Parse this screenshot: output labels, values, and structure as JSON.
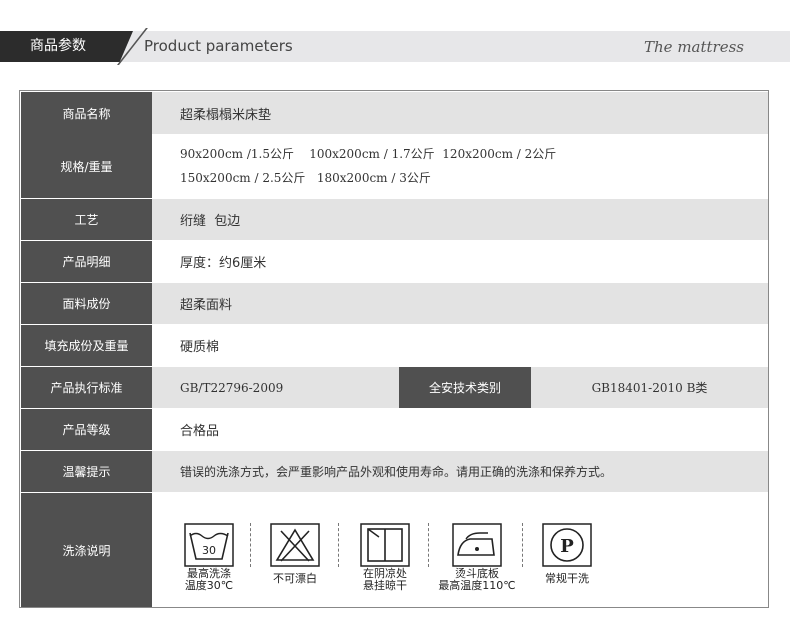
{
  "header": {
    "tab_label": "商品参数",
    "subtitle": "Product parameters",
    "brand": "The mattress"
  },
  "rows": {
    "name": {
      "label": "商品名称",
      "value": "超柔榻榻米床垫"
    },
    "spec": {
      "label": "规格/重量",
      "line1": "90x200cm /1.5公斤    100x200cm / 1.7公斤  120x200cm / 2公斤",
      "line2": "150x200cm / 2.5公斤   180x200cm / 3公斤"
    },
    "craft": {
      "label": "工艺",
      "value": "绗缝  包边"
    },
    "detail": {
      "label": "产品明细",
      "value": "厚度：约6厘米"
    },
    "fabric": {
      "label": "面料成份",
      "value": "超柔面料"
    },
    "filling": {
      "label": "填充成份及重量",
      "value": "硬质棉"
    },
    "standard": {
      "label": "产品执行标准",
      "value": "GB/T22796-2009",
      "safety_label": "全安技术类别",
      "safety_value": "GB18401-2010 B类"
    },
    "grade": {
      "label": "产品等级",
      "value": "合格品"
    },
    "tips": {
      "label": "温馨提示",
      "value": "错误的洗涤方式，会严重影响产品外观和使用寿命。请用正确的洗涤和保养方式。"
    },
    "washing": {
      "label": "洗涤说明",
      "icons": [
        {
          "icon": "wash-30-icon",
          "number": "30",
          "caption1": "最高洗涤",
          "caption2": "温度30℃"
        },
        {
          "icon": "no-bleach-icon",
          "caption1": "不可漂白",
          "caption2": ""
        },
        {
          "icon": "dry-in-shade-icon",
          "caption1": "在阴凉处",
          "caption2": "悬挂晾干"
        },
        {
          "icon": "iron-icon",
          "caption1": "烫斗底板",
          "caption2": "最高温度110℃"
        },
        {
          "icon": "dry-clean-icon",
          "letter": "P",
          "caption1": "常规干洗",
          "caption2": ""
        }
      ]
    }
  }
}
